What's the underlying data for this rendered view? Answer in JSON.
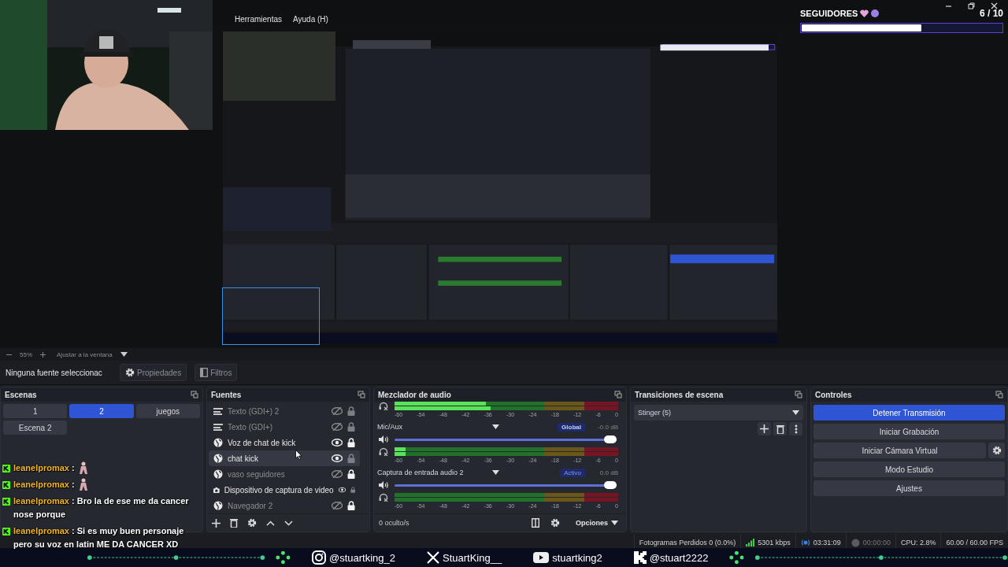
{
  "menu": [
    "Herramientas",
    "Ayuda (H)"
  ],
  "followers": {
    "title": "SEGUIDORES",
    "count": "6 / 10",
    "level": 0.6
  },
  "zoom_bar": {
    "zoom": "55%",
    "fit": "Ajustar a la ventana"
  },
  "source_toolbar": {
    "label": "Ninguna fuente seleccionac",
    "buttons": [
      {
        "label": "Propiedades",
        "kind": "properties"
      },
      {
        "label": "Filtros",
        "kind": "filters"
      }
    ]
  },
  "scenes": {
    "title": "Escenas",
    "items": [
      {
        "label": "1",
        "selected": false
      },
      {
        "label": "2",
        "selected": true
      },
      {
        "label": "juegos",
        "selected": false
      },
      {
        "label": "Escena 2",
        "selected": false
      }
    ]
  },
  "sources": {
    "title": "Fuentes",
    "items": [
      {
        "label": "Texto (GDI+) 2",
        "kind": "text",
        "visible": false,
        "locked": false,
        "selected": false
      },
      {
        "label": "Texto (GDI+)",
        "kind": "text",
        "visible": false,
        "locked": false,
        "selected": false
      },
      {
        "label": "Voz de chat de kick",
        "kind": "browser",
        "visible": true,
        "locked": true,
        "selected": false
      },
      {
        "label": "chat kick",
        "kind": "browser",
        "visible": true,
        "locked": false,
        "selected": true
      },
      {
        "label": "vaso seguidores",
        "kind": "browser",
        "visible": false,
        "locked": true,
        "selected": false
      },
      {
        "label": "Dispositivo de captura de video",
        "kind": "camera",
        "visible": true,
        "locked": false,
        "selected": false
      },
      {
        "label": "Navegador 2",
        "kind": "browser",
        "visible": false,
        "locked": true,
        "selected": false
      }
    ]
  },
  "mixer": {
    "title": "Mezclador de audio",
    "channels": [
      {
        "meters": [
          {
            "level": 0.41
          },
          {
            "level": 0.43
          }
        ],
        "scale": [
          "-60",
          "-54",
          "-48",
          "-42",
          "-36",
          "-30",
          "-24",
          "-18",
          "-12",
          "-6",
          "0"
        ]
      },
      {
        "name": "Mic/Aux",
        "badge": "Global",
        "reading": "-0.0 dB",
        "volume": {
          "level": 1
        },
        "meters": [
          {
            "level": 0.05
          },
          {
            "level": 0.05
          }
        ],
        "scale": [
          "-60",
          "-54",
          "-48",
          "-42",
          "-36",
          "-30",
          "-24",
          "-18",
          "-12",
          "-6",
          "0"
        ]
      },
      {
        "name": "Captura de entrada audio 2",
        "badge": "Activo",
        "reading": "0.0 dB",
        "volume": {
          "level": 1
        },
        "meters": [
          {
            "level": 0
          },
          {
            "level": 0
          }
        ],
        "scale": [
          "-60",
          "-54",
          "-48",
          "-42",
          "-36",
          "-30",
          "-24",
          "-18",
          "-12",
          "-6",
          "0"
        ]
      }
    ],
    "hidden": "0 oculto/s",
    "options": "Opciones"
  },
  "transitions": {
    "title": "Transiciones de escena",
    "current": "Stinger (5)"
  },
  "controls": {
    "title": "Controles",
    "buttons": [
      {
        "label": "Detener Transmisión",
        "kind": "primary"
      },
      {
        "label": "Iniciar Grabación",
        "kind": "normal"
      },
      {
        "label": "Iniciar Cámara Virtual",
        "kind": "with_settings"
      },
      {
        "label": "Modo Estudio",
        "kind": "normal"
      },
      {
        "label": "Ajustes",
        "kind": "normal"
      }
    ]
  },
  "status": {
    "dropped": "Fotogramas Perdidos 0 (0.0%)",
    "bitrate": "5301 kbps",
    "stream_time": "03:31:09",
    "record_time": "00:00:00",
    "cpu": "CPU: 2.8%",
    "fps": "60.00 / 60.00 FPS"
  },
  "chat": [
    {
      "user": "leanelpromax",
      "sep": ":",
      "emote": true
    },
    {
      "user": "leanelpromax",
      "sep": ":",
      "emote": true
    },
    {
      "user": "leanelpromax",
      "sep": ":",
      "text": "Bro la de ese me da cancer nose porque",
      "emote": false
    },
    {
      "user": "leanelpromax",
      "sep": ":",
      "text": "Si es muy buen personaje pero su voz en latin ME DA CANCER XD",
      "emote": false
    }
  ],
  "social": [
    {
      "kind": "instagram",
      "handle": "@stuartking_2"
    },
    {
      "kind": "x",
      "handle": "StuartKing__"
    },
    {
      "kind": "youtube",
      "handle": "stuartking2"
    },
    {
      "kind": "kick",
      "handle": "@stuart2222"
    }
  ]
}
